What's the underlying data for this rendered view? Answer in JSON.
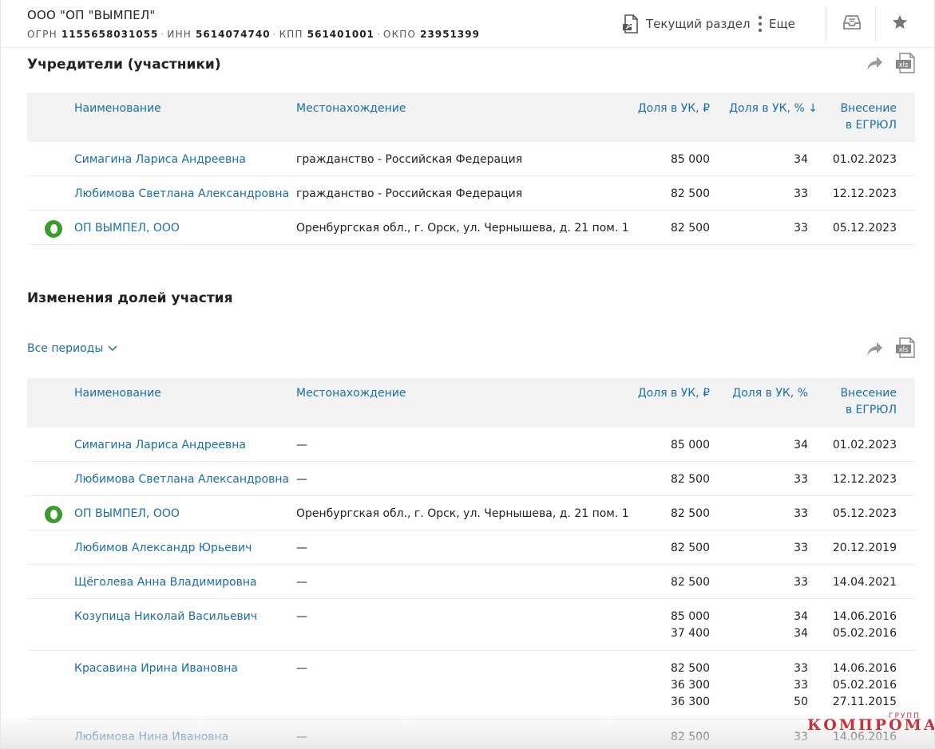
{
  "header": {
    "company_name": "ООО \"ОП \"ВЫМПЕЛ\"",
    "ids": [
      {
        "label": "ОГРН",
        "value": "1155658031055"
      },
      {
        "label": "ИНН",
        "value": "5614074740"
      },
      {
        "label": "КПП",
        "value": "561401001"
      },
      {
        "label": "ОКПО",
        "value": "23951399"
      }
    ],
    "pdf_label": "Текущий раздел",
    "more_label": "Еще"
  },
  "founders": {
    "title": "Учредители (участники)",
    "columns": {
      "name": "Наименование",
      "location": "Местонахождение",
      "share_rub": "Доля в УК, ₽",
      "share_pct": "Доля в УК, % ↓",
      "date_line1": "Внесение",
      "date_line2": "в ЕГРЮЛ"
    },
    "rows": [
      {
        "name": "Симагина Лариса Андреевна",
        "location": "гражданство - Российская Федерация",
        "share_rub": "85 000",
        "share_pct": "34",
        "date": "01.02.2023",
        "org": false
      },
      {
        "name": "Любимова Светлана Александровна",
        "location": "гражданство - Российская Федерация",
        "share_rub": "82 500",
        "share_pct": "33",
        "date": "12.12.2023",
        "org": false
      },
      {
        "name": "ОП ВЫМПЕЛ, ООО",
        "location": "Оренбургская обл., г. Орск, ул. Чернышева, д. 21 пом. 1",
        "share_rub": "82 500",
        "share_pct": "33",
        "date": "05.12.2023",
        "org": true
      }
    ]
  },
  "changes": {
    "title": "Изменения долей участия",
    "period_label": "Все периоды",
    "columns": {
      "name": "Наименование",
      "location": "Местонахождение",
      "share_rub": "Доля в УК, ₽",
      "share_pct": "Доля в УК, %",
      "date_line1": "Внесение",
      "date_line2": "в ЕГРЮЛ"
    },
    "rows": [
      {
        "name": "Симагина Лариса Андреевна",
        "location": "—",
        "org": false,
        "entries": [
          {
            "share_rub": "85 000",
            "share_pct": "34",
            "date": "01.02.2023"
          }
        ]
      },
      {
        "name": "Любимова Светлана Александровна",
        "location": "—",
        "org": false,
        "entries": [
          {
            "share_rub": "82 500",
            "share_pct": "33",
            "date": "12.12.2023"
          }
        ]
      },
      {
        "name": "ОП ВЫМПЕЛ, ООО",
        "location": "Оренбургская обл., г. Орск, ул. Чернышева, д. 21 пом. 1",
        "org": true,
        "entries": [
          {
            "share_rub": "82 500",
            "share_pct": "33",
            "date": "05.12.2023"
          }
        ]
      },
      {
        "name": "Любимов Александр Юрьевич",
        "location": "—",
        "org": false,
        "entries": [
          {
            "share_rub": "82 500",
            "share_pct": "33",
            "date": "20.12.2019"
          }
        ]
      },
      {
        "name": "Щёголева Анна Владимировна",
        "location": "—",
        "org": false,
        "entries": [
          {
            "share_rub": "82 500",
            "share_pct": "33",
            "date": "14.04.2021"
          }
        ]
      },
      {
        "name": "Козупица Николай Васильевич",
        "location": "—",
        "org": false,
        "entries": [
          {
            "share_rub": "85 000",
            "share_pct": "34",
            "date": "14.06.2016"
          },
          {
            "share_rub": "37 400",
            "share_pct": "34",
            "date": "05.02.2016"
          }
        ]
      },
      {
        "name": "Красавина Ирина Ивановна",
        "location": "—",
        "org": false,
        "entries": [
          {
            "share_rub": "82 500",
            "share_pct": "33",
            "date": "14.06.2016"
          },
          {
            "share_rub": "36 300",
            "share_pct": "33",
            "date": "05.02.2016"
          },
          {
            "share_rub": "36 300",
            "share_pct": "50",
            "date": "27.11.2015"
          }
        ]
      },
      {
        "name": "Любимова Нина Ивановна",
        "location": "—",
        "org": false,
        "entries": [
          {
            "share_rub": "82 500",
            "share_pct": "33",
            "date": "14.06.2016"
          }
        ]
      }
    ]
  },
  "watermark": {
    "main": "КОМПРОМАТ",
    "sub": "ГРУПП"
  },
  "colors": {
    "link": "#1a6fa8",
    "org_badge": "#3a9b2f",
    "table_head_bg": "#f3f3f3",
    "watermark": "#c8323a"
  },
  "icons": [
    "pdf-icon",
    "more-vertical-icon",
    "inbox-icon",
    "star-icon",
    "share-arrow-icon",
    "xls-icon",
    "chevron-down-icon",
    "org-status-icon"
  ]
}
